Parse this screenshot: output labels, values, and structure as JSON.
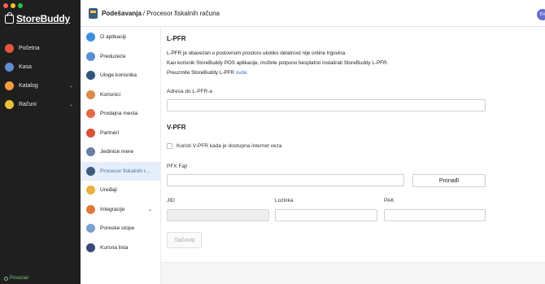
{
  "app": {
    "brand": "StoreBuddy",
    "traffic_colors": [
      "#ff5f57",
      "#febc2e",
      "#28c840"
    ],
    "status": "Povezan"
  },
  "sidebar": {
    "items": [
      {
        "label": "Početna",
        "icon": "home-icon",
        "color": "#e8553f"
      },
      {
        "label": "Kasa",
        "icon": "cash-register-icon",
        "color": "#5b8fd1"
      },
      {
        "label": "Katalog",
        "icon": "catalog-icon",
        "color": "#f0a040",
        "chevron": "⌄"
      },
      {
        "label": "Računi",
        "icon": "receipt-icon",
        "color": "#e8c33a",
        "chevron": "⌄"
      }
    ]
  },
  "header": {
    "section": "Podešavanja",
    "separator": "/",
    "page": "Procesor fiskalnih računa",
    "avatar_initials": "DV"
  },
  "subnav": {
    "items": [
      {
        "label": "O aplikaciji",
        "color": "#3d8fe0",
        "active": false
      },
      {
        "label": "Preduzeće",
        "color": "#5a8fd8",
        "active": false
      },
      {
        "label": "Uloge korisnika",
        "color": "#33547a",
        "active": false
      },
      {
        "label": "Korisnici",
        "color": "#e08a4a",
        "active": false
      },
      {
        "label": "Prodajna mesta",
        "color": "#e46a4a",
        "active": false
      },
      {
        "label": "Partneri",
        "color": "#d8503a",
        "active": false
      },
      {
        "label": "Jedinice mere",
        "color": "#6a7fa0",
        "active": false
      },
      {
        "label": "Procesor fiskalnih r...",
        "color": "#3c5d7e",
        "active": true
      },
      {
        "label": "Uređaji",
        "color": "#e8b040",
        "active": false
      },
      {
        "label": "Integracije",
        "color": "#e07a3a",
        "active": false,
        "chevron": "⌄"
      },
      {
        "label": "Poreske stope",
        "color": "#7aa0d0",
        "active": false
      },
      {
        "label": "Kursna lista",
        "color": "#3a4a7a",
        "active": false
      }
    ]
  },
  "lpfr": {
    "title": "L-PFR",
    "line1": "L-PFR je obavezan u poslovnom prostoru ukoliko delatnost nije online trgovina.",
    "line2": "Kao korisnik StoreBuddy POS aplikacije, možete potpuno besplatno instalirati StoreBuddy L-PFR.",
    "line3_prefix": "Preuzmite StoreBuddy L-PFR ",
    "line3_link": "ovde",
    "line3_suffix": ".",
    "address_label": "Adresa do L-PFR-a",
    "address_value": ""
  },
  "vpfr": {
    "title": "V-PFR",
    "checkbox_label": "Koristi V-PFR kada je dostupna internet veza",
    "pfx_label": "PFX Fajl",
    "pfx_value": "",
    "find_button": "Pronađi",
    "jid_label": "JID",
    "jid_value": "",
    "password_label": "Lozinka",
    "password_value": "",
    "pak_label": "PAK",
    "pak_value": ""
  },
  "save_button": "Sačuvaj"
}
